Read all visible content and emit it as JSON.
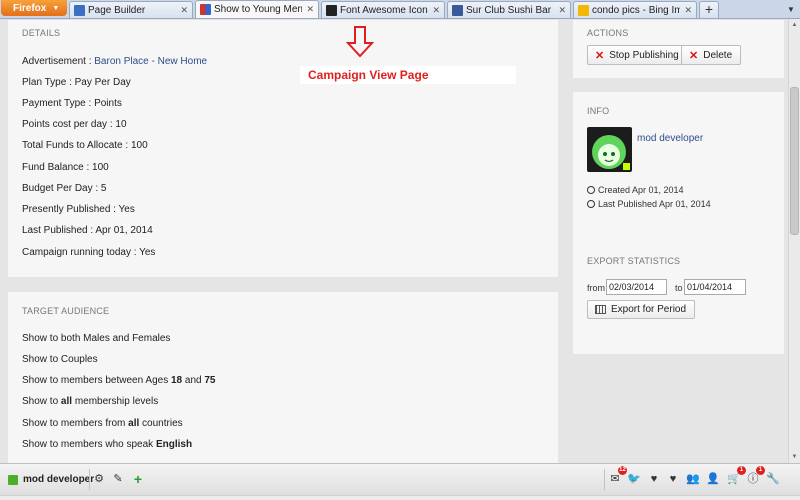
{
  "browser": {
    "app_button": "Firefox",
    "tabs": [
      {
        "label": "Page Builder",
        "active": false
      },
      {
        "label": "Show to Young Men",
        "active": true
      },
      {
        "label": "Font Awesome Icons",
        "active": false
      },
      {
        "label": "Sur Club Sushi Bar",
        "active": false
      },
      {
        "label": "condo pics - Bing Images",
        "active": false
      }
    ],
    "new_tab": "+"
  },
  "annotation": {
    "label": "Campaign View Page",
    "color": "#e02020"
  },
  "details": {
    "title": "DETAILS",
    "advertisement_label": "Advertisement : ",
    "advertisement_value": "Baron Place - New Home",
    "lines": [
      "Plan Type : Pay Per Day",
      "Payment Type : Points",
      "Points cost per day : 10",
      "Total Funds to Allocate : 100",
      "Fund Balance : 100",
      "Budget Per Day : 5",
      "Presently Published : Yes",
      "Last Published : Apr 01, 2014",
      "Campaign running today : Yes"
    ]
  },
  "target": {
    "title": "TARGET AUDIENCE",
    "line1": "Show to both Males and Females",
    "line2": "Show to Couples",
    "line3": {
      "pre": "Show to members between Ages ",
      "a": "18",
      "mid": " and ",
      "b": "75"
    },
    "line4": {
      "pre": "Show to ",
      "b": "all",
      "post": " membership levels"
    },
    "line5": {
      "pre": "Show to members from ",
      "b": "all",
      "post": " countries"
    },
    "line6": {
      "pre": "Show to members who speak ",
      "b": "English"
    }
  },
  "actions": {
    "title": "ACTIONS",
    "stop_label": "Stop Publishing",
    "delete_label": "Delete"
  },
  "info": {
    "title": "INFO",
    "name": "mod developer",
    "created": "Created Apr 01, 2014",
    "last_published": "Last Published Apr 01, 2014"
  },
  "export": {
    "title": "EXPORT STATISTICS",
    "from_label": "from",
    "from_value": "02/03/2014",
    "to_label": "to",
    "to_value": "01/04/2014",
    "button_label": "Export for Period"
  },
  "bottombar": {
    "user": "mod developer",
    "mail_badge": "12",
    "cart_badge": "1",
    "info_badge": "1",
    "accent": "#4caf2a"
  }
}
